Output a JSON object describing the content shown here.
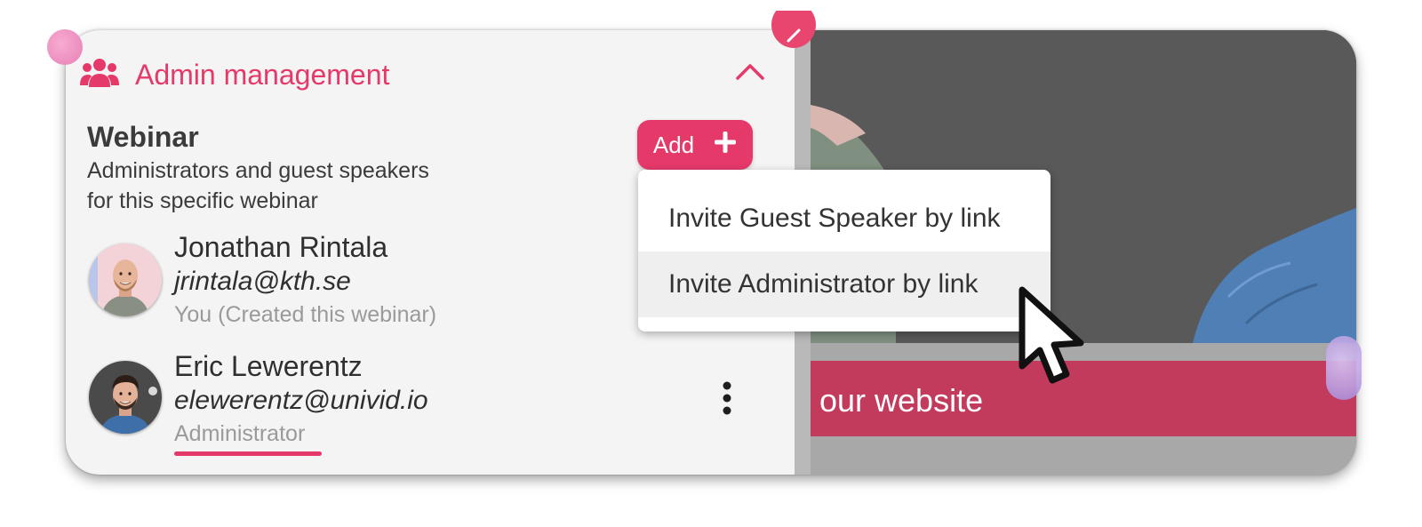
{
  "section": {
    "title": "Admin management",
    "icon": "users-icon",
    "collapse_icon": "chevron-up-icon",
    "accent_color": "#e5396a"
  },
  "webinar": {
    "title": "Webinar",
    "description_line1": "Administrators and guest speakers",
    "description_line2": "for this specific webinar"
  },
  "add_button": {
    "label": "Add",
    "icon": "plus-icon"
  },
  "people": [
    {
      "name": "Jonathan Rintala",
      "email": "jrintala@kth.se",
      "role": "You (Created this webinar)"
    },
    {
      "name": "Eric Lewerentz",
      "email": "elewerentz@univid.io",
      "role": "Administrator",
      "menu_icon": "kebab-menu-icon"
    }
  ],
  "dropdown": {
    "items": [
      {
        "label": "Invite Guest Speaker by link"
      },
      {
        "label": "Invite Administrator by link",
        "hovered": true
      }
    ]
  },
  "preview": {
    "banner_text": "our website",
    "banner_color": "#c23a5c"
  }
}
